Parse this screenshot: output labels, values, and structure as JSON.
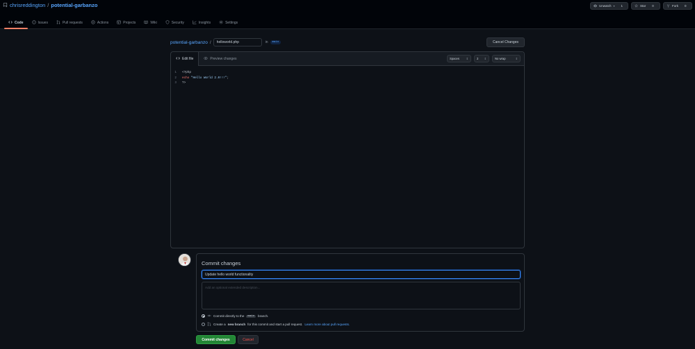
{
  "repo": {
    "owner": "chrisreddington",
    "separator": "/",
    "name": "potential-garbanzo"
  },
  "actions": {
    "unwatch": {
      "label": "Unwatch",
      "count": "1"
    },
    "star": {
      "label": "Star",
      "count": "0"
    },
    "fork": {
      "label": "Fork",
      "count": "0"
    }
  },
  "tabs": [
    {
      "label": "Code",
      "icon": "code-icon",
      "active": true
    },
    {
      "label": "Issues",
      "icon": "issue-icon"
    },
    {
      "label": "Pull requests",
      "icon": "pull-request-icon"
    },
    {
      "label": "Actions",
      "icon": "play-icon"
    },
    {
      "label": "Projects",
      "icon": "table-icon"
    },
    {
      "label": "Wiki",
      "icon": "book-icon"
    },
    {
      "label": "Security",
      "icon": "shield-icon"
    },
    {
      "label": "Insights",
      "icon": "graph-icon"
    },
    {
      "label": "Settings",
      "icon": "gear-icon"
    }
  ],
  "breadcrumb": {
    "repo": "potential-garbanzo",
    "separator": "/",
    "filename": "helloworld.php",
    "in_text": "in",
    "branch": "main"
  },
  "cancel_changes": "Cancel Changes",
  "editor": {
    "tab_edit": "Edit file",
    "tab_preview": "Preview changes",
    "indent_mode": "Spaces",
    "indent_size": "2",
    "wrap_mode": "No wrap",
    "lines": [
      {
        "num": "1",
        "text": "<?php"
      },
      {
        "num": "2",
        "keyword": "echo",
        "string": " \"Hello World 2.0!!!\"",
        "rest": ";"
      },
      {
        "num": "3",
        "text": "?>"
      }
    ]
  },
  "commit": {
    "title": "Commit changes",
    "message": "Update hello world functionality",
    "description_placeholder": "Add an optional extended description...",
    "direct_prefix": "Commit directly to the",
    "direct_branch": "main",
    "direct_suffix": "branch.",
    "pr_prefix": "Create a",
    "pr_strong": "new branch",
    "pr_middle": "for this commit and start a pull request.",
    "pr_link": "Learn more about pull requests.",
    "submit": "Commit changes",
    "cancel": "Cancel"
  },
  "colors": {
    "accent": "#58a6ff",
    "primary_button": "#238636",
    "danger": "#f85149",
    "tab_underline": "#f78166"
  }
}
